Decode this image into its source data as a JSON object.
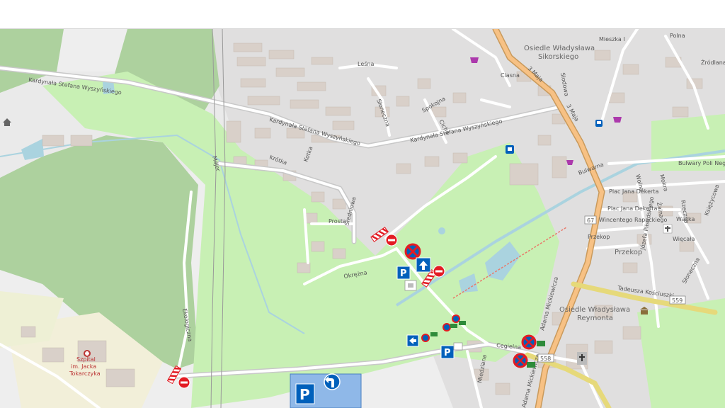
{
  "map": {
    "street_labels": [
      {
        "key": "wyszynskiego_w",
        "text": "Kardynała Stefana Wyszyńskiego"
      },
      {
        "key": "wyszynskiego_mid",
        "text": "Kardynała Stefana Wyszyńskiego"
      },
      {
        "key": "wyszynskiego_e",
        "text": "Kardynała Stefana Wyszyńskiego"
      },
      {
        "key": "lesna",
        "text": "Leśna"
      },
      {
        "key": "krotka",
        "text": "Krótka"
      },
      {
        "key": "kotka",
        "text": "Kotka"
      },
      {
        "key": "sredniowa",
        "text": "Średniowa"
      },
      {
        "key": "prosta",
        "text": "Prosta"
      },
      {
        "key": "okrezna",
        "text": "Okrężna"
      },
      {
        "key": "spokojna",
        "text": "Spokojna"
      },
      {
        "key": "cicha",
        "text": "Cicha"
      },
      {
        "key": "ciasna",
        "text": "Ciasna"
      },
      {
        "key": "sloneczna",
        "text": "Słoneczna"
      },
      {
        "key": "slodowa",
        "text": "Słodowa"
      },
      {
        "key": "maja_n",
        "text": "3 Maja"
      },
      {
        "key": "maja_s",
        "text": "3 Maja"
      },
      {
        "key": "mieszka",
        "text": "Mieszka I"
      },
      {
        "key": "polna",
        "text": "Polna"
      },
      {
        "key": "zrodlana",
        "text": "Źródlana"
      },
      {
        "key": "bulwarna",
        "text": "Bulwarna"
      },
      {
        "key": "bulwary",
        "text": "Bulwary Poli Neg"
      },
      {
        "key": "plac_dekerta1",
        "text": "Plac Jana Dekerta"
      },
      {
        "key": "plac_dekerta2",
        "text": "Plac Jana Dekerta"
      },
      {
        "key": "wincentego",
        "text": "Wincentego Rapackiego"
      },
      {
        "key": "przekop_st",
        "text": "Przekop"
      },
      {
        "key": "przekop",
        "text": "Przekop"
      },
      {
        "key": "rzeczna",
        "text": "Rzeczna"
      },
      {
        "key": "waska",
        "text": "Wąska"
      },
      {
        "key": "wiecala",
        "text": "Więcała"
      },
      {
        "key": "zalna",
        "text": "Żalna"
      },
      {
        "key": "wolna",
        "text": "Wolna"
      },
      {
        "key": "mokra",
        "text": "Mokra"
      },
      {
        "key": "ksiezycowa",
        "text": "Księżycowa"
      },
      {
        "key": "sloneczna2",
        "text": "Słoneczna"
      },
      {
        "key": "pilsudskiego",
        "text": "Józefa Piłsudskiego"
      },
      {
        "key": "kosciuszki",
        "text": "Tadeusza Kościuszki"
      },
      {
        "key": "mickiewicza1",
        "text": "Adama Mickiewicza"
      },
      {
        "key": "mickiewicza2",
        "text": "Adama Mickiewicza"
      },
      {
        "key": "cegielna",
        "text": "Cegielna"
      },
      {
        "key": "miedziana",
        "text": "Miedziana"
      },
      {
        "key": "ekologiczna",
        "text": "Ekologiczna"
      },
      {
        "key": "majer",
        "text": "Majer"
      }
    ],
    "area_labels": [
      {
        "key": "sikorskiego1",
        "text": "Osiedle Władysława"
      },
      {
        "key": "sikorskiego2",
        "text": "Sikorskiego"
      },
      {
        "key": "reymonta1",
        "text": "Osiedle Władysława"
      },
      {
        "key": "reymonta2",
        "text": "Reymonta"
      },
      {
        "key": "szpital1",
        "text": "Szpital"
      },
      {
        "key": "szpital2",
        "text": "im. Jacka"
      },
      {
        "key": "szpital3",
        "text": "Tokarczyka"
      }
    ],
    "route_shields": [
      {
        "key": "r67",
        "text": "67"
      },
      {
        "key": "r559",
        "text": "559"
      },
      {
        "key": "r558",
        "text": "558"
      }
    ],
    "parking_letter": "P",
    "colors": {
      "forest": "#add19e",
      "park": "#c8f0b4",
      "residential": "#e0dfdf",
      "building": "#d9d0c9",
      "road": "#ffffff",
      "major_road": "#f7c184",
      "water": "#aad3df",
      "no_entry_red": "#e31b23",
      "sign_blue": "#0060bb",
      "parking_overlay": "#8fb8e8"
    }
  }
}
